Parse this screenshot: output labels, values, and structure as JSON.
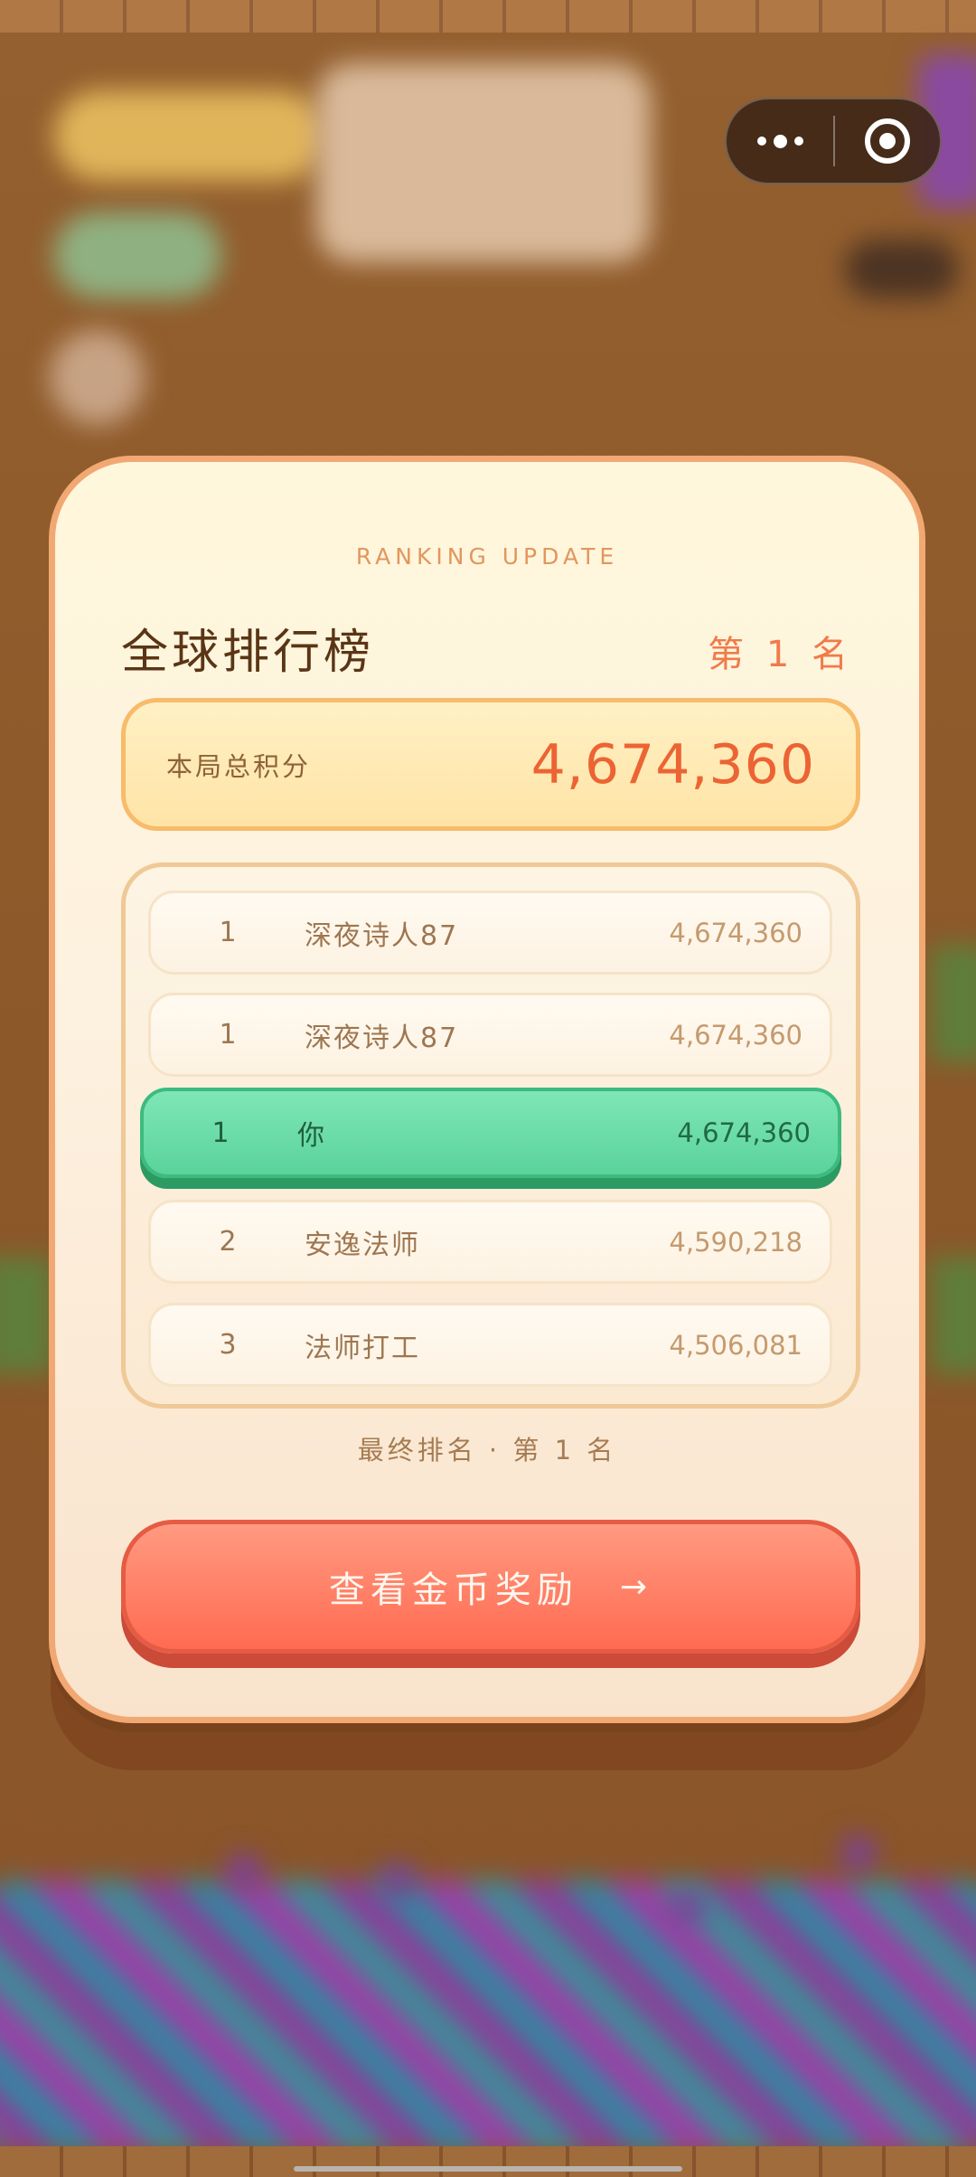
{
  "modal": {
    "ribbon": "RANKING UPDATE",
    "title": "全球排行榜",
    "rank_badge": "第 1 名",
    "score_label": "本局总积分",
    "score_value": "4,674,360",
    "final_rank": "最终排名 · 第 1 名",
    "cta_label": "查看金币奖励",
    "cta_arrow": "→"
  },
  "leaderboard": [
    {
      "rank": "1",
      "name": "深夜诗人87",
      "score": "4,674,360",
      "is_player": false
    },
    {
      "rank": "1",
      "name": "深夜诗人87",
      "score": "4,674,360",
      "is_player": false
    },
    {
      "rank": "1",
      "name": "你",
      "score": "4,674,360",
      "is_player": true
    },
    {
      "rank": "2",
      "name": "安逸法师",
      "score": "4,590,218",
      "is_player": false
    },
    {
      "rank": "3",
      "name": "法师打工",
      "score": "4,506,081",
      "is_player": false
    }
  ],
  "capsule": {
    "more_icon": "more-dots-icon",
    "close_icon": "target-close-icon"
  },
  "colors": {
    "accent": "#ec6433",
    "player_row": "#5ad39b",
    "cta": "#ff6b52",
    "modal_border": "#f2a873"
  }
}
